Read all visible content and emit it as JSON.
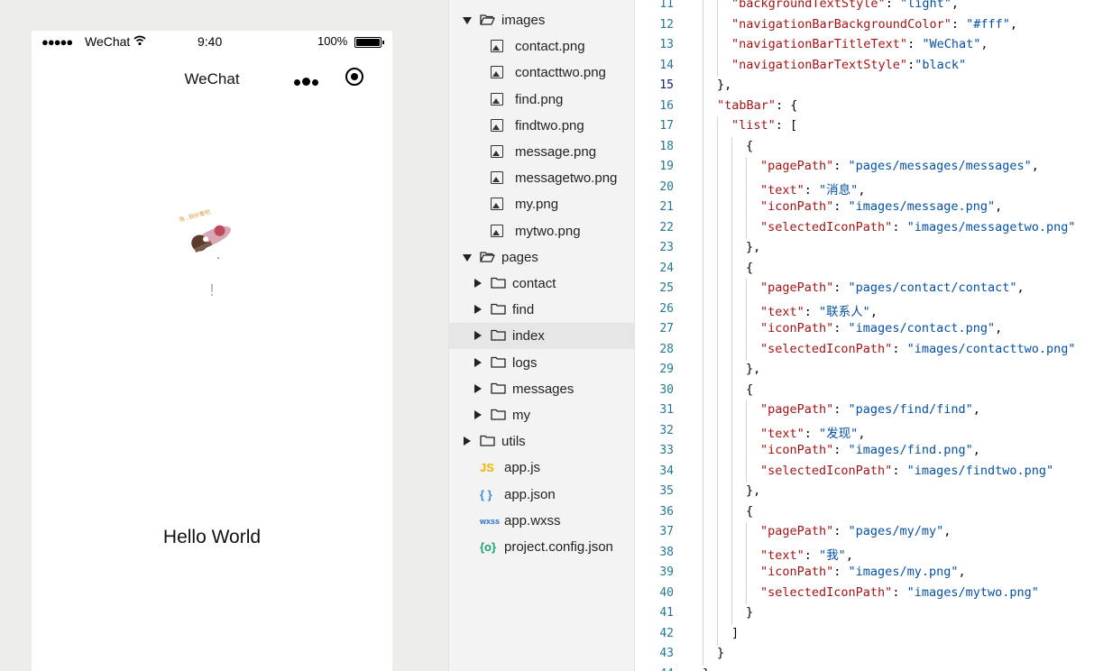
{
  "simulator": {
    "status": {
      "signal": "●●●●●",
      "carrier": "WeChat",
      "time": "9:40",
      "battery_pct": "100%"
    },
    "nav_title": "WeChat",
    "sticker_caption": "我...就好看吧.",
    "userinfo_text": "!",
    "motto": "Hello World"
  },
  "file_tree": [
    {
      "label": "images",
      "type": "folder",
      "open": true,
      "depth": 0
    },
    {
      "label": "contact.png",
      "type": "image",
      "depth": 1
    },
    {
      "label": "contacttwo.png",
      "type": "image",
      "depth": 1
    },
    {
      "label": "find.png",
      "type": "image",
      "depth": 1
    },
    {
      "label": "findtwo.png",
      "type": "image",
      "depth": 1
    },
    {
      "label": "message.png",
      "type": "image",
      "depth": 1
    },
    {
      "label": "messagetwo.png",
      "type": "image",
      "depth": 1
    },
    {
      "label": "my.png",
      "type": "image",
      "depth": 1
    },
    {
      "label": "mytwo.png",
      "type": "image",
      "depth": 1
    },
    {
      "label": "pages",
      "type": "folder",
      "open": true,
      "depth": 0
    },
    {
      "label": "contact",
      "type": "folder",
      "open": false,
      "depth": 1
    },
    {
      "label": "find",
      "type": "folder",
      "open": false,
      "depth": 1
    },
    {
      "label": "index",
      "type": "folder",
      "open": false,
      "depth": 1,
      "selected": true
    },
    {
      "label": "logs",
      "type": "folder",
      "open": false,
      "depth": 1
    },
    {
      "label": "messages",
      "type": "folder",
      "open": false,
      "depth": 1
    },
    {
      "label": "my",
      "type": "folder",
      "open": false,
      "depth": 1
    },
    {
      "label": "utils",
      "type": "folder",
      "open": false,
      "depth": 0
    },
    {
      "label": "app.js",
      "type": "js",
      "badge": "JS",
      "depth": 0
    },
    {
      "label": "app.json",
      "type": "json",
      "badge": "{ }",
      "depth": 0
    },
    {
      "label": "app.wxss",
      "type": "wxss",
      "badge": "wxss",
      "depth": 0
    },
    {
      "label": "project.config.json",
      "type": "config",
      "badge": "{o}",
      "depth": 0
    }
  ],
  "editor": {
    "current_line": 15,
    "lines": [
      {
        "n": 11,
        "indent": 1,
        "parts": [
          [
            "k",
            "\"backgroundTextStyle\""
          ],
          [
            "p",
            ": "
          ],
          [
            "s",
            "\"light\""
          ],
          [
            "p",
            ","
          ]
        ]
      },
      {
        "n": 12,
        "indent": 1,
        "parts": [
          [
            "k",
            "\"navigationBarBackgroundColor\""
          ],
          [
            "p",
            ": "
          ],
          [
            "s",
            "\"#fff\""
          ],
          [
            "p",
            ","
          ]
        ]
      },
      {
        "n": 13,
        "indent": 1,
        "parts": [
          [
            "k",
            "\"navigationBarTitleText\""
          ],
          [
            "p",
            ": "
          ],
          [
            "s",
            "\"WeChat\""
          ],
          [
            "p",
            ","
          ]
        ]
      },
      {
        "n": 14,
        "indent": 1,
        "parts": [
          [
            "k",
            "\"navigationBarTextStyle\""
          ],
          [
            "p",
            ":"
          ],
          [
            "s",
            "\"black\""
          ]
        ]
      },
      {
        "n": 15,
        "indent": 0,
        "parts": [
          [
            "p",
            "},"
          ]
        ]
      },
      {
        "n": 16,
        "indent": 0,
        "parts": [
          [
            "k",
            "\"tabBar\""
          ],
          [
            "p",
            ": {"
          ]
        ]
      },
      {
        "n": 17,
        "indent": 1,
        "parts": [
          [
            "k",
            "\"list\""
          ],
          [
            "p",
            ": ["
          ]
        ]
      },
      {
        "n": 18,
        "indent": 2,
        "parts": [
          [
            "p",
            "{"
          ]
        ]
      },
      {
        "n": 19,
        "indent": 3,
        "parts": [
          [
            "k",
            "\"pagePath\""
          ],
          [
            "p",
            ": "
          ],
          [
            "s",
            "\"pages/messages/messages\""
          ],
          [
            "p",
            ","
          ]
        ]
      },
      {
        "n": 20,
        "indent": 3,
        "parts": [
          [
            "k",
            "\"text\""
          ],
          [
            "p",
            ": "
          ],
          [
            "s",
            "\"消息\""
          ],
          [
            "p",
            ","
          ]
        ]
      },
      {
        "n": 21,
        "indent": 3,
        "parts": [
          [
            "k",
            "\"iconPath\""
          ],
          [
            "p",
            ": "
          ],
          [
            "s",
            "\"images/message.png\""
          ],
          [
            "p",
            ","
          ]
        ]
      },
      {
        "n": 22,
        "indent": 3,
        "parts": [
          [
            "k",
            "\"selectedIconPath\""
          ],
          [
            "p",
            ": "
          ],
          [
            "s",
            "\"images/messagetwo.png\""
          ]
        ]
      },
      {
        "n": 23,
        "indent": 2,
        "parts": [
          [
            "p",
            "},"
          ]
        ]
      },
      {
        "n": 24,
        "indent": 2,
        "parts": [
          [
            "p",
            "{"
          ]
        ]
      },
      {
        "n": 25,
        "indent": 3,
        "parts": [
          [
            "k",
            "\"pagePath\""
          ],
          [
            "p",
            ": "
          ],
          [
            "s",
            "\"pages/contact/contact\""
          ],
          [
            "p",
            ","
          ]
        ]
      },
      {
        "n": 26,
        "indent": 3,
        "parts": [
          [
            "k",
            "\"text\""
          ],
          [
            "p",
            ": "
          ],
          [
            "s",
            "\"联系人\""
          ],
          [
            "p",
            ","
          ]
        ]
      },
      {
        "n": 27,
        "indent": 3,
        "parts": [
          [
            "k",
            "\"iconPath\""
          ],
          [
            "p",
            ": "
          ],
          [
            "s",
            "\"images/contact.png\""
          ],
          [
            "p",
            ","
          ]
        ]
      },
      {
        "n": 28,
        "indent": 3,
        "parts": [
          [
            "k",
            "\"selectedIconPath\""
          ],
          [
            "p",
            ": "
          ],
          [
            "s",
            "\"images/contacttwo.png\""
          ]
        ]
      },
      {
        "n": 29,
        "indent": 2,
        "parts": [
          [
            "p",
            "},"
          ]
        ]
      },
      {
        "n": 30,
        "indent": 2,
        "parts": [
          [
            "p",
            "{"
          ]
        ]
      },
      {
        "n": 31,
        "indent": 3,
        "parts": [
          [
            "k",
            "\"pagePath\""
          ],
          [
            "p",
            ": "
          ],
          [
            "s",
            "\"pages/find/find\""
          ],
          [
            "p",
            ","
          ]
        ]
      },
      {
        "n": 32,
        "indent": 3,
        "parts": [
          [
            "k",
            "\"text\""
          ],
          [
            "p",
            ": "
          ],
          [
            "s",
            "\"发现\""
          ],
          [
            "p",
            ","
          ]
        ]
      },
      {
        "n": 33,
        "indent": 3,
        "parts": [
          [
            "k",
            "\"iconPath\""
          ],
          [
            "p",
            ": "
          ],
          [
            "s",
            "\"images/find.png\""
          ],
          [
            "p",
            ","
          ]
        ]
      },
      {
        "n": 34,
        "indent": 3,
        "parts": [
          [
            "k",
            "\"selectedIconPath\""
          ],
          [
            "p",
            ": "
          ],
          [
            "s",
            "\"images/findtwo.png\""
          ]
        ]
      },
      {
        "n": 35,
        "indent": 2,
        "parts": [
          [
            "p",
            "},"
          ]
        ]
      },
      {
        "n": 36,
        "indent": 2,
        "parts": [
          [
            "p",
            "{"
          ]
        ]
      },
      {
        "n": 37,
        "indent": 3,
        "parts": [
          [
            "k",
            "\"pagePath\""
          ],
          [
            "p",
            ": "
          ],
          [
            "s",
            "\"pages/my/my\""
          ],
          [
            "p",
            ","
          ]
        ]
      },
      {
        "n": 38,
        "indent": 3,
        "parts": [
          [
            "k",
            "\"text\""
          ],
          [
            "p",
            ": "
          ],
          [
            "s",
            "\"我\""
          ],
          [
            "p",
            ","
          ]
        ]
      },
      {
        "n": 39,
        "indent": 3,
        "parts": [
          [
            "k",
            "\"iconPath\""
          ],
          [
            "p",
            ": "
          ],
          [
            "s",
            "\"images/my.png\""
          ],
          [
            "p",
            ","
          ]
        ]
      },
      {
        "n": 40,
        "indent": 3,
        "parts": [
          [
            "k",
            "\"selectedIconPath\""
          ],
          [
            "p",
            ": "
          ],
          [
            "s",
            "\"images/mytwo.png\""
          ]
        ]
      },
      {
        "n": 41,
        "indent": 2,
        "parts": [
          [
            "p",
            "}"
          ]
        ]
      },
      {
        "n": 42,
        "indent": 1,
        "parts": [
          [
            "p",
            "]"
          ]
        ]
      },
      {
        "n": 43,
        "indent": 0,
        "parts": [
          [
            "p",
            "}"
          ]
        ]
      },
      {
        "n": 44,
        "indent": -1,
        "parts": [
          [
            "p",
            "}"
          ]
        ]
      }
    ]
  }
}
